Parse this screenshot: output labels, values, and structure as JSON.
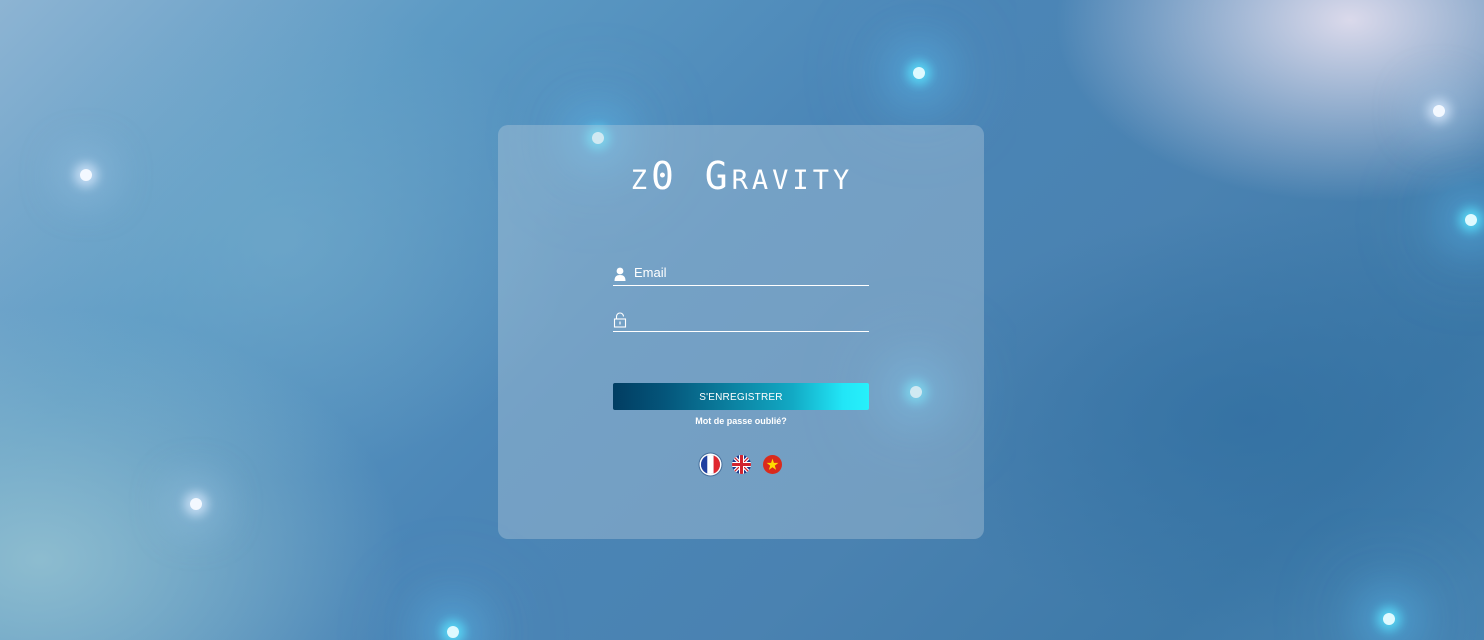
{
  "brand": {
    "logo_text": "z0 Gravity"
  },
  "login": {
    "email_placeholder": "Email",
    "email_value": "",
    "password_placeholder": "",
    "password_value": "",
    "submit_label": "S'ENREGISTRER",
    "forgot_label": "Mot de passe oublié?"
  },
  "languages": [
    {
      "code": "fr",
      "icon": "flag-france-icon",
      "active": true
    },
    {
      "code": "en",
      "icon": "flag-uk-icon",
      "active": false
    },
    {
      "code": "vi",
      "icon": "flag-vietnam-icon",
      "active": false
    }
  ],
  "colors": {
    "button_gradient_start": "#013d62",
    "button_gradient_end": "#27f0fb",
    "text": "#ffffff"
  },
  "icons": {
    "email": "user-icon",
    "password": "lock-icon"
  }
}
